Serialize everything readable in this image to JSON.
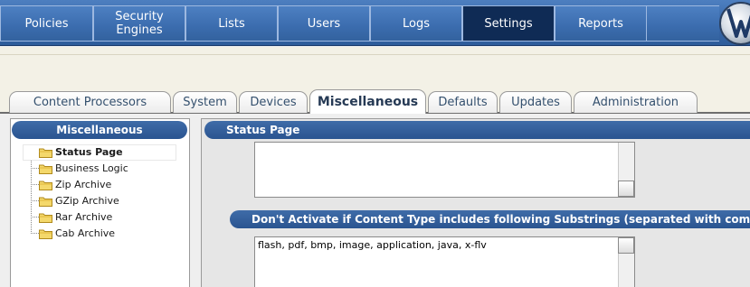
{
  "nav": {
    "items": [
      {
        "label": "Policies",
        "active": false
      },
      {
        "label": "Security\nEngines",
        "active": false
      },
      {
        "label": "Lists",
        "active": false
      },
      {
        "label": "Users",
        "active": false
      },
      {
        "label": "Logs",
        "active": false
      },
      {
        "label": "Settings",
        "active": true
      },
      {
        "label": "Reports",
        "active": false
      }
    ],
    "logo_icon": "brand-logo-icon"
  },
  "tabs": {
    "items": [
      {
        "label": "Content Processors",
        "active": false
      },
      {
        "label": "System",
        "active": false
      },
      {
        "label": "Devices",
        "active": false
      },
      {
        "label": "Miscellaneous",
        "active": true
      },
      {
        "label": "Defaults",
        "active": false
      },
      {
        "label": "Updates",
        "active": false
      },
      {
        "label": "Administration",
        "active": false
      }
    ]
  },
  "sidebar": {
    "title": "Miscellaneous",
    "items": [
      {
        "label": "Status Page",
        "selected": true,
        "icon": "folder-icon"
      },
      {
        "label": "Business Logic",
        "selected": false,
        "icon": "folder-icon"
      },
      {
        "label": "Zip Archive",
        "selected": false,
        "icon": "folder-icon"
      },
      {
        "label": "GZip Archive",
        "selected": false,
        "icon": "folder-icon"
      },
      {
        "label": "Rar Archive",
        "selected": false,
        "icon": "folder-icon"
      },
      {
        "label": "Cab Archive",
        "selected": false,
        "icon": "folder-icon"
      }
    ]
  },
  "main": {
    "status_section": {
      "title": "Status Page",
      "value": ""
    },
    "content_type_section": {
      "title": "Don't Activate if Content Type includes following Substrings (separated with commas)",
      "value": "flash, pdf, bmp, image, application, java, x-flv"
    }
  },
  "colors": {
    "nav_blue": "#3a6aab",
    "nav_active": "#0f2b55",
    "header_blue": "#2a5490",
    "band_beige": "#f3f1e6",
    "folder_yellow": "#f4d86b"
  }
}
